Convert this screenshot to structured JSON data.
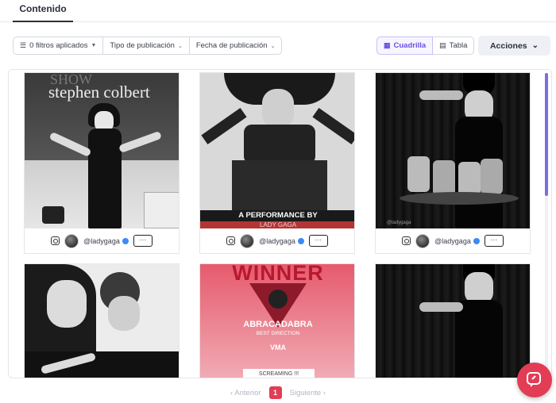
{
  "tabs": {
    "active_label": "Contenido"
  },
  "filters": {
    "applied_label": "0 filtros aplicados",
    "type_label": "Tipo de publicación",
    "date_label": "Fecha de publicación"
  },
  "view": {
    "grid_label": "Cuadrilla",
    "table_label": "Tabla"
  },
  "actions": {
    "label": "Acciones"
  },
  "cards": [
    {
      "handle": "@ladygaga",
      "more": "···",
      "thumb_text": "stephen colbert",
      "thumb_text2": "SHOW"
    },
    {
      "handle": "@ladygaga",
      "more": "···",
      "thumb_text": "A PERFORMANCE BY",
      "thumb_text2": "LADY GAGA"
    },
    {
      "handle": "@ladygaga",
      "more": "···",
      "thumb_text": "@ladygaga"
    },
    {
      "handle": "",
      "more": "",
      "thumb_text": ""
    },
    {
      "handle": "",
      "more": "",
      "thumb_text": "WINNER",
      "thumb_text2": "ABRACADABRA",
      "thumb_text3": "BEST DIRECTION",
      "thumb_text4": "VMA",
      "thumb_text5": "SCREAMING !!!"
    },
    {
      "handle": "",
      "more": "",
      "thumb_text": ""
    }
  ],
  "pagination": {
    "prev_label": "Anterior",
    "current_page": "1",
    "next_label": "Siguiente"
  },
  "colors": {
    "accent": "#6c4fe0",
    "brand": "#e23d55"
  }
}
